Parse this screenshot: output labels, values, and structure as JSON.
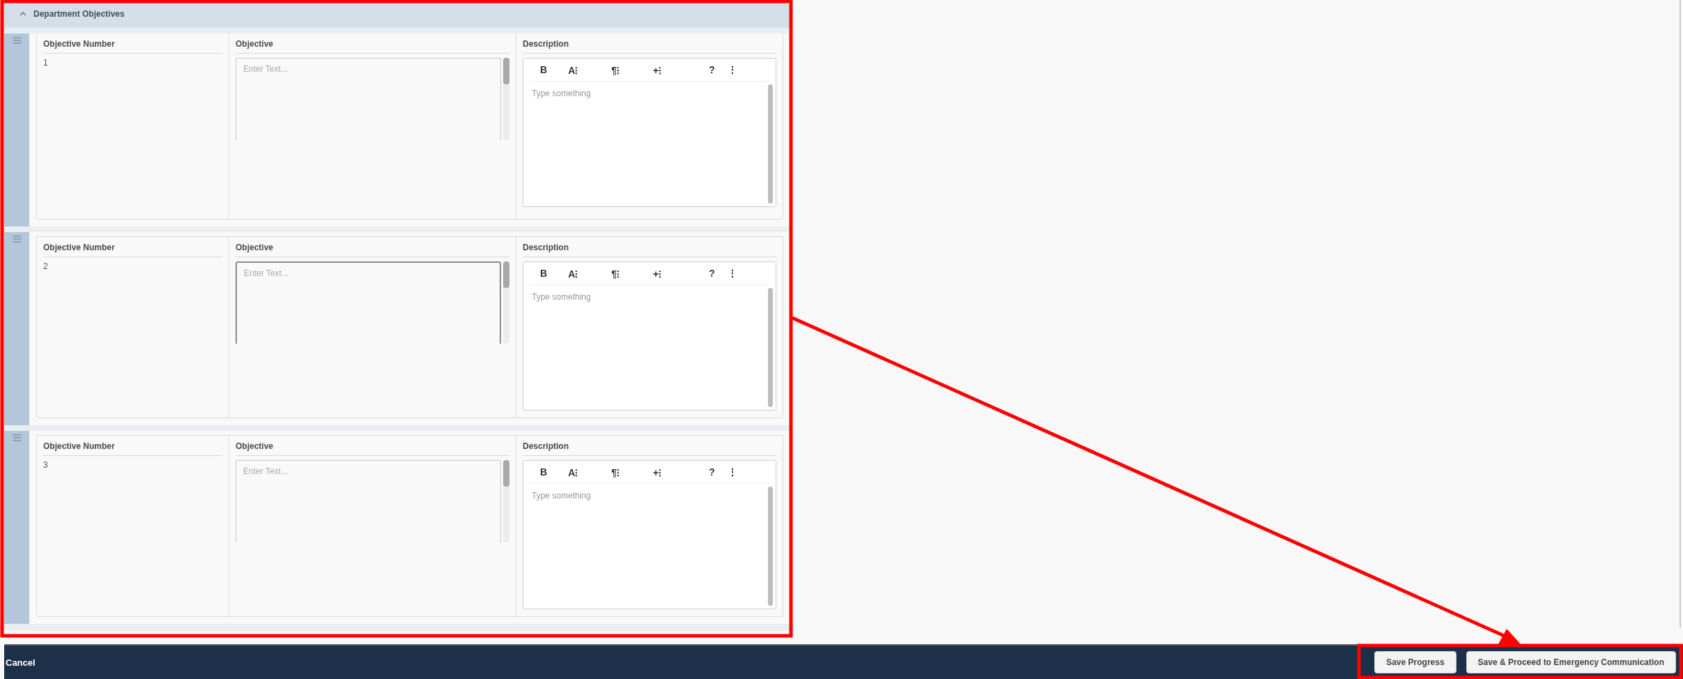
{
  "section": {
    "title": "Department Objectives",
    "expanded": true
  },
  "objectives": [
    {
      "columns": [
        "Objective Number",
        "Objective",
        "Description"
      ],
      "number": "1",
      "objective_placeholder": "Enter Text...",
      "objective_focused": false,
      "toolbar": [
        "B",
        "A⁝",
        "¶⁝",
        "+⁝",
        "?",
        "⋮"
      ],
      "description_placeholder": "Type something"
    },
    {
      "columns": [
        "Objective Number",
        "Objective",
        "Description"
      ],
      "number": "2",
      "objective_placeholder": "Enter Text...",
      "objective_focused": true,
      "toolbar": [
        "B",
        "A⁝",
        "¶⁝",
        "+⁝",
        "?",
        "⋮"
      ],
      "description_placeholder": "Type something"
    },
    {
      "columns": [
        "Objective Number",
        "Objective",
        "Description"
      ],
      "number": "3",
      "objective_placeholder": "Enter Text...",
      "objective_focused": false,
      "toolbar": [
        "B",
        "A⁝",
        "¶⁝",
        "+⁝",
        "?",
        "⋮"
      ],
      "description_placeholder": "Type something"
    }
  ],
  "footer": {
    "cancel": "Cancel",
    "buttons": [
      "Save Progress",
      "Save & Proceed to Emergency Communication"
    ]
  }
}
